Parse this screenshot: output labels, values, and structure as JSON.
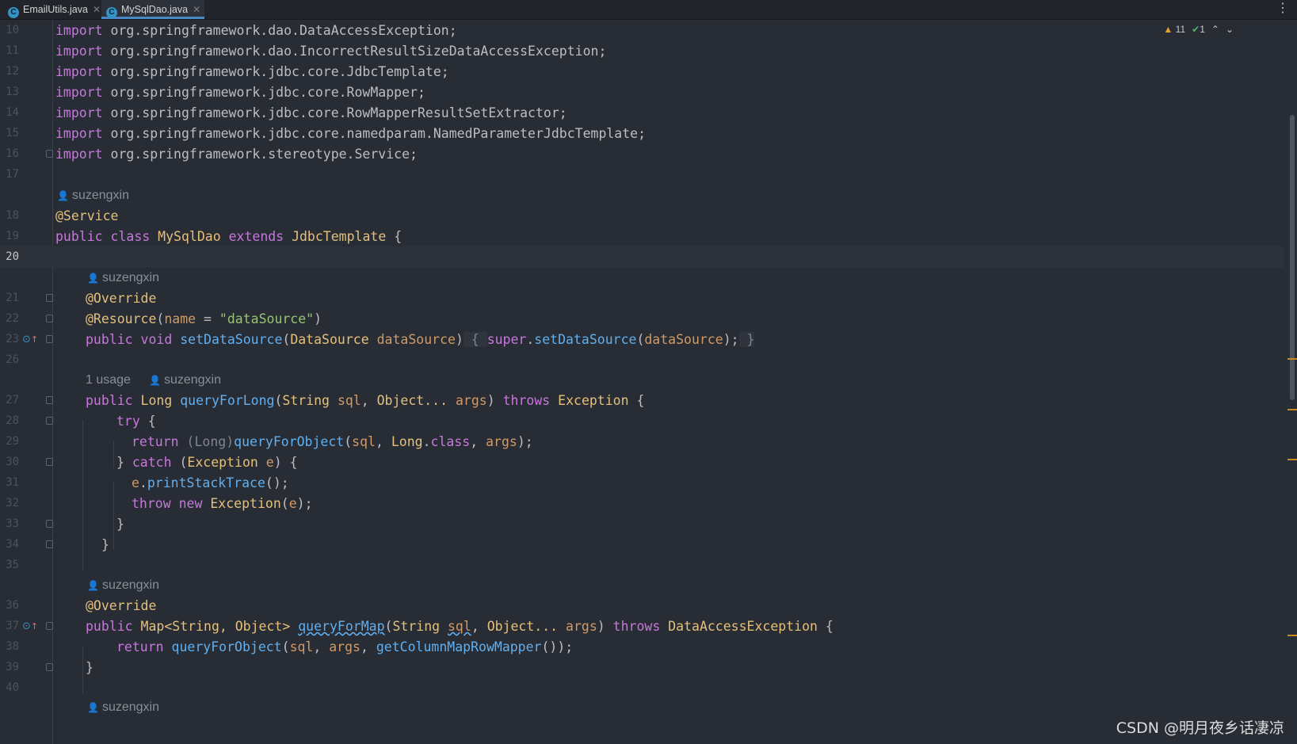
{
  "tabs": [
    {
      "label": "EmailUtils.java",
      "icon": "C",
      "active": false
    },
    {
      "label": "MySqlDao.java",
      "icon": "C",
      "active": true
    }
  ],
  "inspections": {
    "warnings": "11",
    "ok": "1"
  },
  "author": "suzengxin",
  "usage": "1 usage",
  "lines": {
    "l10": "10",
    "l11": "11",
    "l12": "12",
    "l13": "13",
    "l14": "14",
    "l15": "15",
    "l16": "16",
    "l17": "17",
    "l18": "18",
    "l19": "19",
    "l20": "20",
    "l21": "21",
    "l22": "22",
    "l23": "23",
    "l26": "26",
    "l27": "27",
    "l28": "28",
    "l29": "29",
    "l30": "30",
    "l31": "31",
    "l32": "32",
    "l33": "33",
    "l34": "34",
    "l35": "35",
    "l36": "36",
    "l37": "37",
    "l38": "38",
    "l39": "39",
    "l40": "40"
  },
  "code": {
    "kw_import": "import",
    "imp10": " org.springframework.dao.DataAccessException;",
    "imp11": " org.springframework.dao.IncorrectResultSizeDataAccessException;",
    "imp12": " org.springframework.jdbc.core.JdbcTemplate;",
    "imp13": " org.springframework.jdbc.core.RowMapper;",
    "imp14": " org.springframework.jdbc.core.RowMapperResultSetExtractor;",
    "imp15": " org.springframework.jdbc.core.namedparam.NamedParameterJdbcTemplate;",
    "imp16": " org.springframework.stereotype.Service;",
    "ann_service": "@Service",
    "kw_public": "public",
    "kw_class": "class",
    "cls_name": "MySqlDao",
    "kw_extends": "extends",
    "cls_super": "JdbcTemplate",
    "brace_open": " {",
    "ann_override": "@Override",
    "ann_resource": "@Resource",
    "res_open": "(",
    "res_name": "name",
    "res_eq": " = ",
    "res_value": "\"dataSource\"",
    "res_close": ")",
    "kw_void": "void",
    "fn_setDataSource": "setDataSource",
    "type_DataSource": "DataSource",
    "param_dataSource": "dataSource",
    "kw_super": "super",
    "type_Long": "Long",
    "fn_queryForLong": "queryForLong",
    "type_String": "String",
    "param_sql": "sql",
    "type_Object": "Object...",
    "param_args": "args",
    "kw_throws": "throws",
    "type_Exception": "Exception",
    "kw_try": "try",
    "kw_return": "return",
    "cast_Long": "(Long)",
    "fn_queryForObject": "queryForObject",
    "kw_class_literal": "class",
    "kw_catch": "catch",
    "param_e": "e",
    "fn_printStackTrace": "printStackTrace",
    "kw_throw": "throw",
    "kw_new": "new",
    "type_Map": "Map<String, Object>",
    "fn_queryForMap": "queryForMap",
    "type_DataAccessException": "DataAccessException",
    "fn_getColumnMapRowMapper": "getColumnMapRowMapper"
  },
  "watermark": "CSDN @明月夜乡话凄凉"
}
